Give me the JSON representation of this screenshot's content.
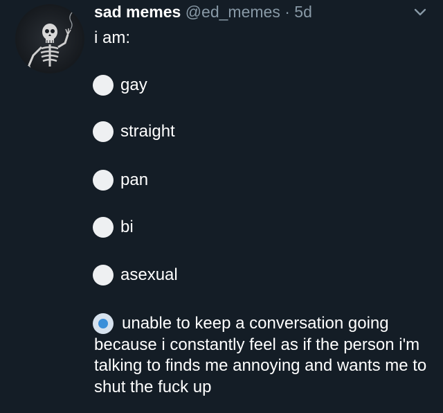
{
  "tweet": {
    "display_name": "sad memes",
    "handle": "@ed_memes",
    "separator": "·",
    "time": "5d",
    "text": "i am:",
    "avatar_icon": "skeleton-avatar",
    "menu_icon": "chevron-down-icon"
  },
  "poll": {
    "options": [
      {
        "label": "gay",
        "selected": false
      },
      {
        "label": "straight",
        "selected": false
      },
      {
        "label": "pan",
        "selected": false
      },
      {
        "label": "bi",
        "selected": false
      },
      {
        "label": "asexual",
        "selected": false
      },
      {
        "label": "unable to keep a conversation going because i constantly feel as if the person i'm talking to finds me annoying and wants me to shut the fuck up",
        "selected": true
      }
    ]
  },
  "colors": {
    "background": "#141d26",
    "secondary_text": "#8899a6",
    "selected_accent": "#3a8fd9"
  }
}
